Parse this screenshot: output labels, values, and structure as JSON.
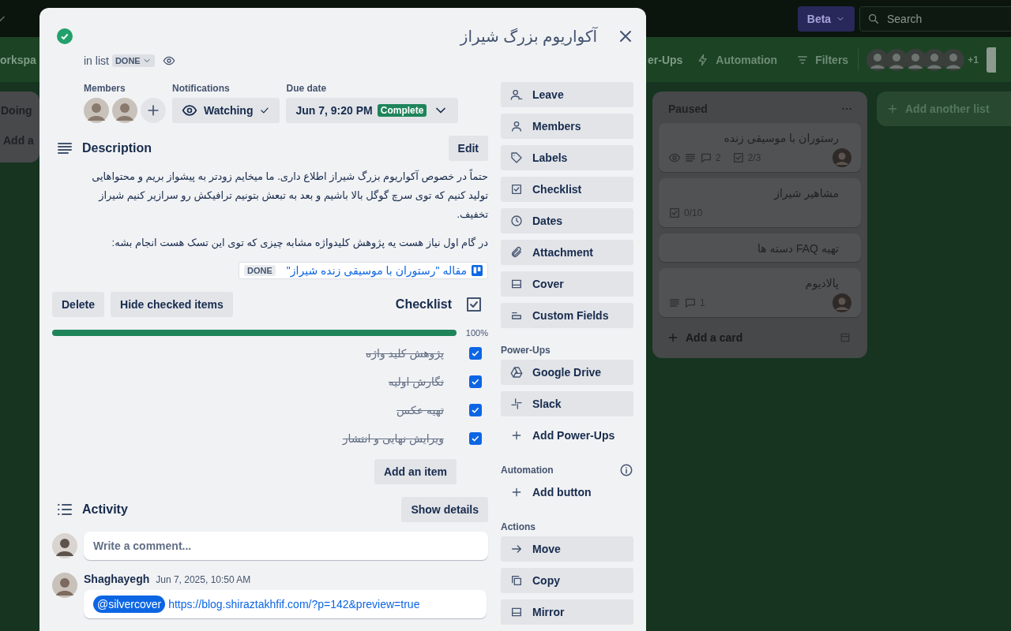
{
  "board": {
    "header": {
      "beta": "Beta",
      "search_placeholder": "Search"
    },
    "board_bar": {
      "workspace_fragment": "orkspa",
      "powerups_fragment": "er-Ups",
      "automation": "Automation",
      "filters": "Filters",
      "member_count": "+1"
    },
    "doing_list": {
      "title": "Doing",
      "add_card": "Add a"
    },
    "paused_list": {
      "title": "Paused",
      "add_card": "Add a card",
      "cards": [
        {
          "title": "رستوران با موسیقی زنده",
          "avatar": true,
          "badges": [
            {
              "kind": "watch"
            },
            {
              "kind": "description"
            },
            {
              "kind": "comments",
              "text": "2"
            },
            {
              "kind": "checklist",
              "text": "2/3"
            }
          ]
        },
        {
          "title": "مشاهیر شیراز",
          "badges": [
            {
              "kind": "checklist",
              "text": "0/10"
            }
          ]
        },
        {
          "title": "تهیه FAQ دسته ها"
        },
        {
          "title": "پالادیوم",
          "avatar": true,
          "badges": [
            {
              "kind": "description"
            },
            {
              "kind": "comments",
              "text": "1"
            }
          ]
        }
      ]
    },
    "add_list": "Add another list"
  },
  "card": {
    "title": "آکواریوم بزرگ شیراز",
    "completed": true,
    "list_label": "in list",
    "list_name": "DONE",
    "members_label": "Members",
    "notifications": {
      "label": "Notifications",
      "button": "Watching",
      "watching": true
    },
    "due": {
      "label": "Due date",
      "date": "Jun 7, 9:20 PM",
      "status": "Complete"
    },
    "description": {
      "title": "Description",
      "edit": "Edit",
      "paragraphs": [
        "حتماً در خصوص آکواریوم بزرگ شیراز اطلاع داری. ما میخایم زودتر به پیشواز بریم و محتواهایی تولید کنیم که توی سرچ گوگل بالا باشیم و بعد به تبعش بتونیم ترافیکش رو سرازیر کنیم شیراز تخفیف.",
        "در گام اول نیاز هست یه پژوهش کلیدواژه مشابه چیزی که توی این تسک هست انجام بشه:"
      ],
      "link": {
        "text": "مقاله \"رستوران با موسیقی زنده شیراز\"",
        "badge": "DONE"
      }
    },
    "checklist": {
      "title": "Checklist",
      "delete": "Delete",
      "hide": "Hide checked items",
      "level": 1,
      "percent": "100%",
      "add_item": "Add an item",
      "items": [
        {
          "text": "پژوهش کلید واژه",
          "checked": true
        },
        {
          "text": "نگارش اولیه",
          "checked": true
        },
        {
          "text": "تهیه عکس",
          "checked": true
        },
        {
          "text": "ویرایش نهایی و انتشار",
          "checked": true
        }
      ]
    },
    "activity": {
      "title": "Activity",
      "show_details": "Show details",
      "comment_placeholder": "Write a comment...",
      "comments": [
        {
          "author": "Shaghayegh",
          "time": "Jun 7, 2025, 10:50 AM",
          "mention": "@silvercover",
          "link": "https://blog.shiraztakhfif.com/?p=142&preview=true"
        }
      ]
    }
  },
  "sidebar": {
    "groups": [
      {
        "items": [
          {
            "label": "Leave",
            "kind": "button"
          },
          {
            "label": "Members",
            "kind": "button"
          },
          {
            "label": "Labels",
            "kind": "button"
          },
          {
            "label": "Checklist",
            "kind": "button"
          },
          {
            "label": "Dates",
            "kind": "button"
          },
          {
            "label": "Attachment",
            "kind": "button"
          },
          {
            "label": "Cover",
            "kind": "button"
          },
          {
            "label": "Custom Fields",
            "kind": "button"
          }
        ]
      },
      {
        "heading": "Power-Ups",
        "items": [
          {
            "label": "Google Drive",
            "kind": "button"
          },
          {
            "label": "Slack",
            "kind": "button"
          },
          {
            "label": "Add Power-Ups",
            "kind": "add"
          }
        ]
      },
      {
        "heading": "Automation",
        "info": true,
        "items": [
          {
            "label": "Add button",
            "kind": "add"
          }
        ]
      },
      {
        "heading": "Actions",
        "items": [
          {
            "label": "Move",
            "kind": "button"
          },
          {
            "label": "Copy",
            "kind": "button"
          },
          {
            "label": "Mirror",
            "kind": "button"
          }
        ]
      }
    ]
  }
}
